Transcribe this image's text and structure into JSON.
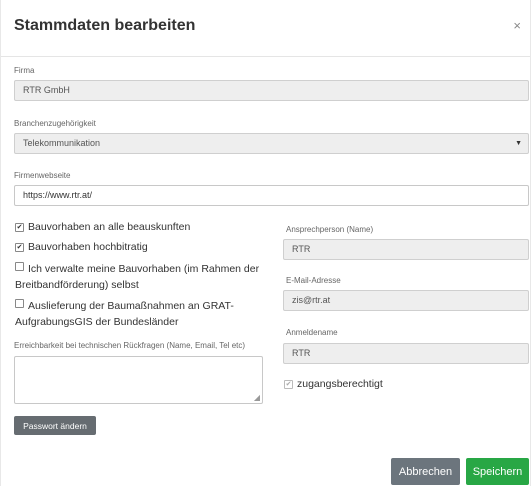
{
  "dialog": {
    "title": "Stammdaten bearbeiten",
    "close_glyph": "×"
  },
  "firma": {
    "label": "Firma",
    "value": "RTR GmbH"
  },
  "branche": {
    "label": "Branchenzugehörigkeit",
    "value": "Telekommunikation",
    "caret": "▼"
  },
  "webseite": {
    "label": "Firmenwebseite",
    "value": "https://www.rtr.at/"
  },
  "checkboxes": [
    {
      "label": "Bauvorhaben an alle beauskunften",
      "checked": true
    },
    {
      "label": "Bauvorhaben hochbitratig",
      "checked": true
    },
    {
      "label_line1": "Ich verwalte meine Bauvorhaben (im Rahmen der",
      "label_line2": "Breitbandförderung) selbst",
      "checked": false
    },
    {
      "label_line1": "Auslieferung der Baumaßnahmen an GRAT-",
      "label_line2": "AufgrabungsGIS der Bundesländer",
      "checked": false
    }
  ],
  "erreichbarkeit": {
    "label": "Erreichbarkeit bei technischen Rückfragen (Name, Email, Tel etc)",
    "value": ""
  },
  "ansprechperson": {
    "label": "Ansprechperson (Name)",
    "value": "RTR"
  },
  "email": {
    "label": "E-Mail-Adresse",
    "value": "zis@rtr.at"
  },
  "anmeldename": {
    "label": "Anmeldename",
    "value": "RTR"
  },
  "zugang": {
    "label": "zugangsberechtigt",
    "checked": true
  },
  "buttons": {
    "passwort": "Passwort ändern",
    "abbrechen": "Abbrechen",
    "speichern": "Speichern"
  },
  "icons": {
    "check": "✔",
    "resize": "◢"
  }
}
